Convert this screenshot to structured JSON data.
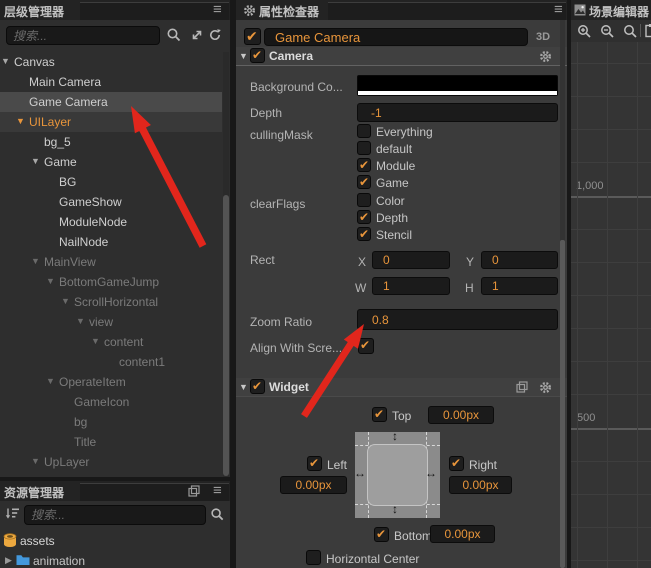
{
  "colors": {
    "accent_orange": "#E8953B",
    "annotation_red": "#E2261C",
    "folder_blue": "#4398DC",
    "selection_gray": "#4A4A4A"
  },
  "hierarchy": {
    "title": "层级管理器",
    "search_placeholder": "搜索...",
    "nodes": [
      {
        "label": "Canvas",
        "level": 0,
        "arrow": "down",
        "style": "normal"
      },
      {
        "label": "Main Camera",
        "level": 1,
        "arrow": "",
        "style": "normal"
      },
      {
        "label": "Game Camera",
        "level": 1,
        "arrow": "",
        "style": "normal",
        "selected": "strong"
      },
      {
        "label": "UILayer",
        "level": 1,
        "arrow": "down",
        "style": "orange",
        "selected": "subtle"
      },
      {
        "label": "bg_5",
        "level": 2,
        "arrow": "",
        "style": "normal"
      },
      {
        "label": "Game",
        "level": 2,
        "arrow": "down",
        "style": "normal"
      },
      {
        "label": "BG",
        "level": 3,
        "arrow": "",
        "style": "normal"
      },
      {
        "label": "GameShow",
        "level": 3,
        "arrow": "",
        "style": "normal"
      },
      {
        "label": "ModuleNode",
        "level": 3,
        "arrow": "",
        "style": "normal"
      },
      {
        "label": "NailNode",
        "level": 3,
        "arrow": "",
        "style": "normal"
      },
      {
        "label": "MainView",
        "level": 2,
        "arrow": "down",
        "style": "muted"
      },
      {
        "label": "BottomGameJump",
        "level": 3,
        "arrow": "down",
        "style": "muted"
      },
      {
        "label": "ScrollHorizontal",
        "level": 4,
        "arrow": "down",
        "style": "muted"
      },
      {
        "label": "view",
        "level": 5,
        "arrow": "down",
        "style": "muted"
      },
      {
        "label": "content",
        "level": 6,
        "arrow": "down",
        "style": "muted"
      },
      {
        "label": "content1",
        "level": 7,
        "arrow": "",
        "style": "muted"
      },
      {
        "label": "OperateItem",
        "level": 3,
        "arrow": "down",
        "style": "muted"
      },
      {
        "label": "GameIcon",
        "level": 4,
        "arrow": "",
        "style": "muted"
      },
      {
        "label": "bg",
        "level": 4,
        "arrow": "",
        "style": "muted"
      },
      {
        "label": "Title",
        "level": 4,
        "arrow": "",
        "style": "muted"
      },
      {
        "label": "UpLayer",
        "level": 2,
        "arrow": "down",
        "style": "muted"
      }
    ]
  },
  "assets": {
    "title": "资源管理器",
    "search_placeholder": "搜索...",
    "items": [
      {
        "label": "assets",
        "icon": "database-icon",
        "expanded": true
      },
      {
        "label": "animation",
        "icon": "folder-icon",
        "expanded": false
      }
    ]
  },
  "inspector": {
    "title": "属性检查器",
    "node": {
      "name": "Game Camera",
      "enabled": true,
      "mode": "3D"
    },
    "camera": {
      "title": "Camera",
      "enabled": true,
      "background_label": "Background Co...",
      "depth_label": "Depth",
      "depth_value": "-1",
      "cullingmask_label": "cullingMask",
      "cullingmask_options": [
        {
          "label": "Everything",
          "checked": false
        },
        {
          "label": "default",
          "checked": false
        },
        {
          "label": "Module",
          "checked": true
        },
        {
          "label": "Game",
          "checked": true
        }
      ],
      "clearflags_label": "clearFlags",
      "clearflags_options": [
        {
          "label": "Color",
          "checked": false
        },
        {
          "label": "Depth",
          "checked": true
        },
        {
          "label": "Stencil",
          "checked": true
        }
      ],
      "rect_label": "Rect",
      "rect": {
        "x_label": "X",
        "x": "0",
        "y_label": "Y",
        "y": "0",
        "w_label": "W",
        "w": "1",
        "h_label": "H",
        "h": "1"
      },
      "zoom_label": "Zoom Ratio",
      "zoom_value": "0.8",
      "align_label": "Align With Scre...",
      "align_checked": true
    },
    "widget": {
      "title": "Widget",
      "enabled": true,
      "top": {
        "label": "Top",
        "value": "0.00px",
        "checked": true
      },
      "left": {
        "label": "Left",
        "value": "0.00px",
        "checked": true
      },
      "right": {
        "label": "Right",
        "value": "0.00px",
        "checked": true
      },
      "bottom": {
        "label": "Bottom",
        "value": "0.00px",
        "checked": true
      },
      "horizontal_center": {
        "label": "Horizontal Center",
        "checked": false
      }
    }
  },
  "scene": {
    "title": "场景编辑器",
    "ruler_label_1000": "1,000",
    "ruler_label_500": "500"
  }
}
